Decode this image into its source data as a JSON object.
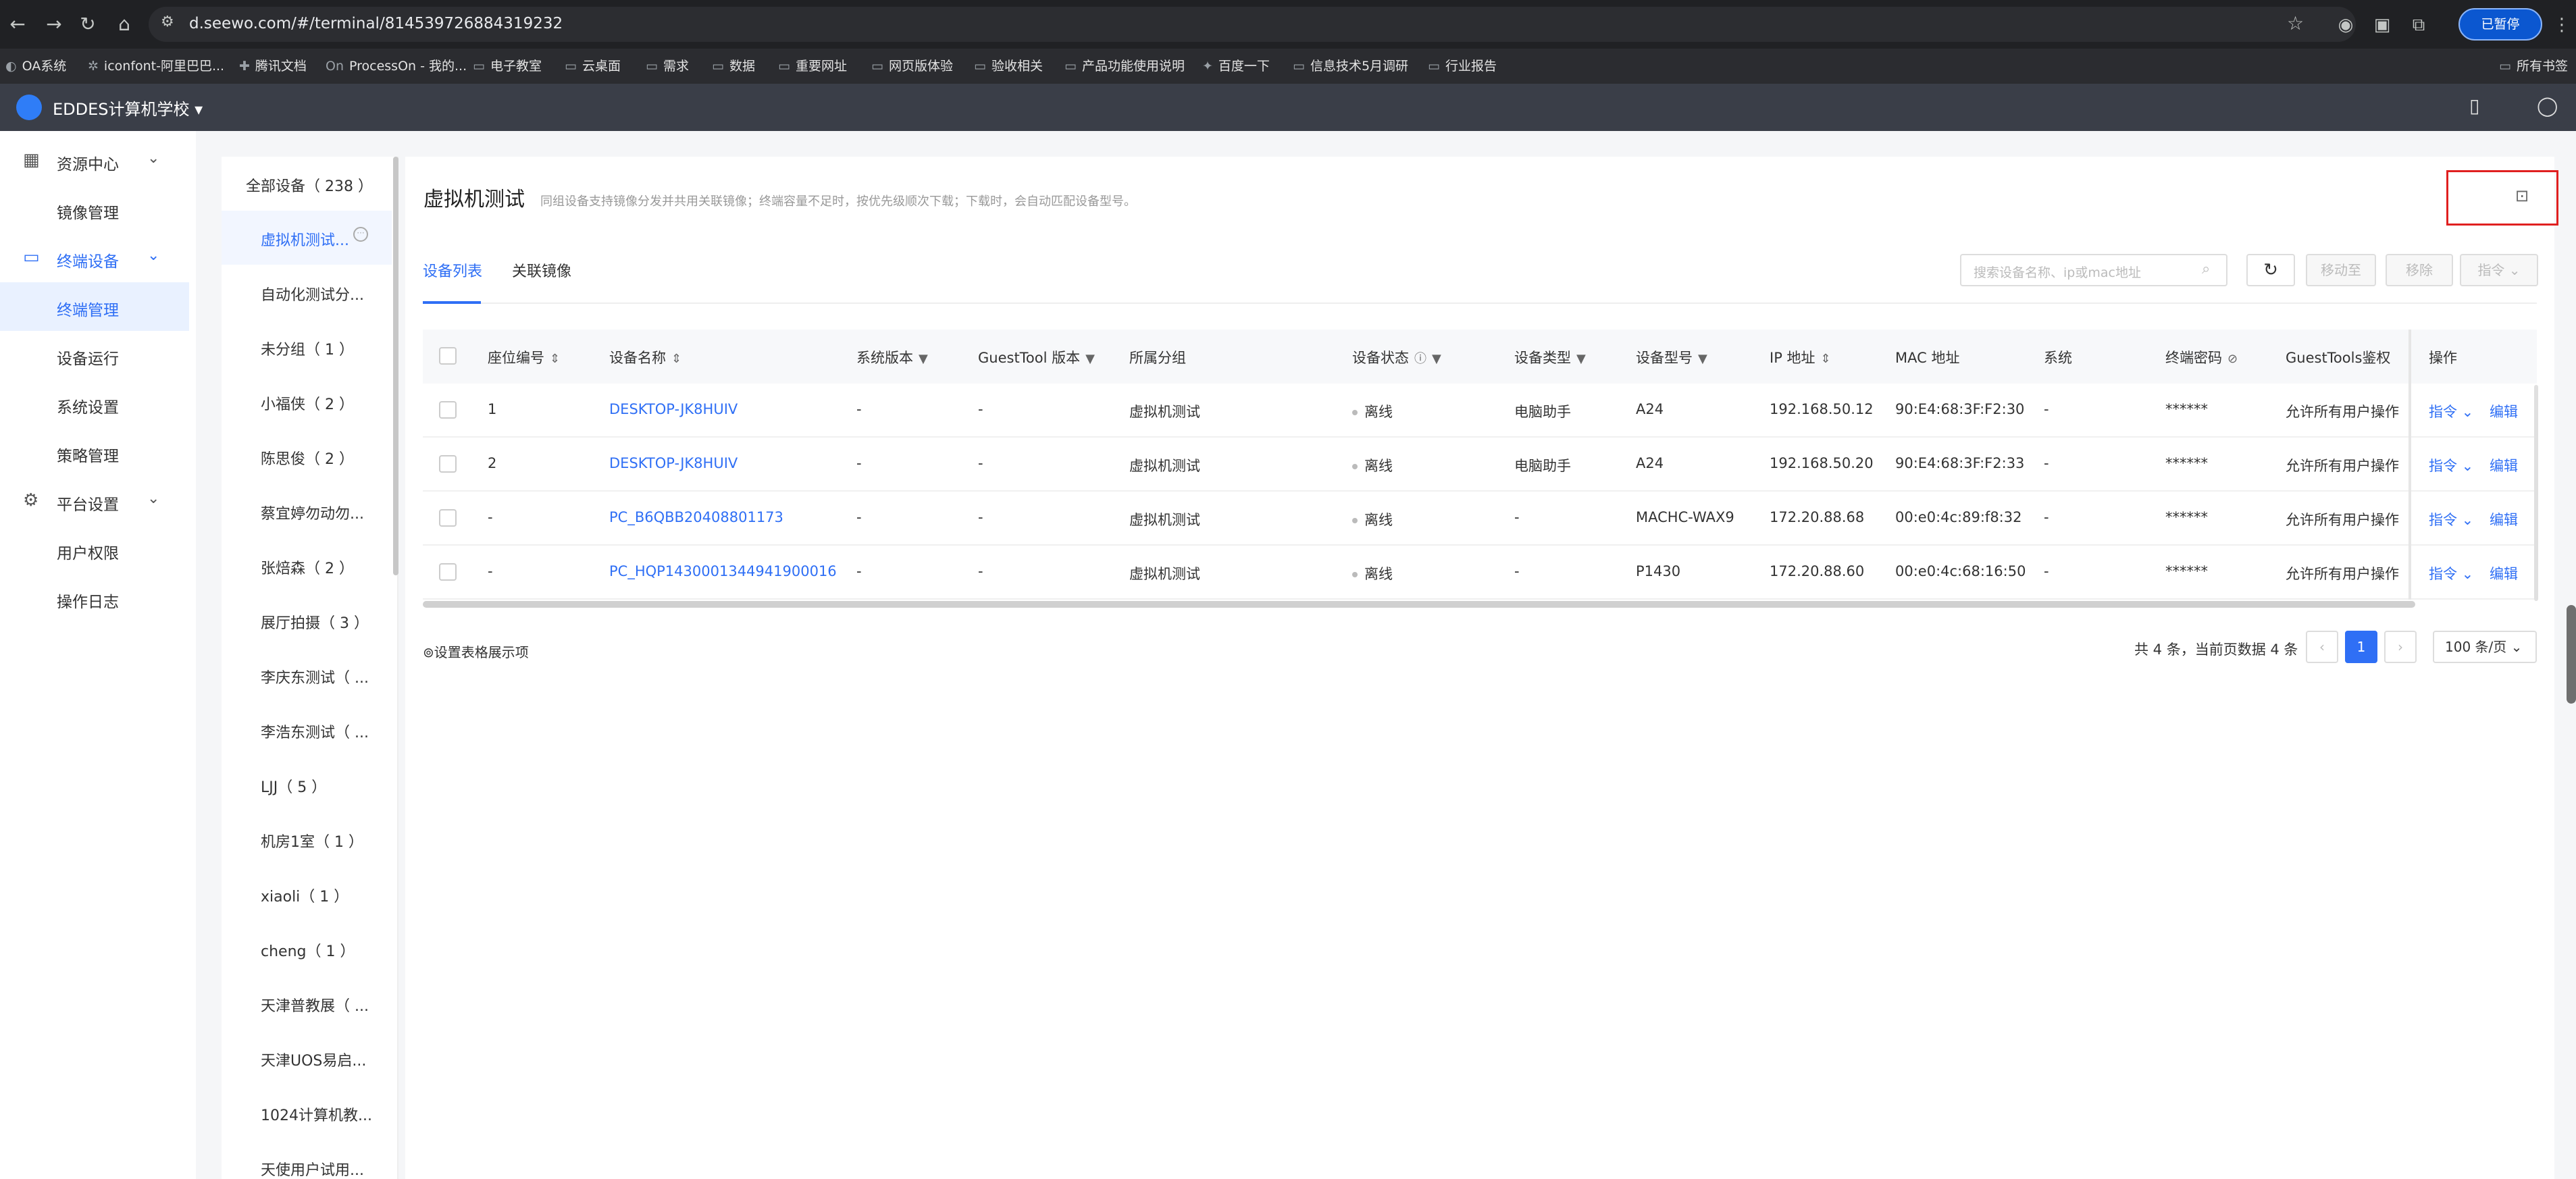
{
  "browser": {
    "url": "d.seewo.com/#/terminal/814539726884319232",
    "profile_label": "已暂停",
    "bookmarks": [
      "OA系统",
      "iconfont-阿里巴巴...",
      "腾讯文档",
      "ProcessOn - 我的...",
      "电子教室",
      "云桌面",
      "需求",
      "数据",
      "重要网址",
      "网页版体验",
      "验收相关",
      "产品功能使用说明",
      "百度一下",
      "信息技术5月调研",
      "行业报告",
      "所有书签"
    ]
  },
  "app": {
    "school_name": "EDDES计算机学校"
  },
  "sidebar": {
    "groups": [
      {
        "label": "资源中心",
        "items": [
          "镜像管理"
        ]
      },
      {
        "label": "终端设备",
        "items": [
          "终端管理",
          "设备运行",
          "系统设置",
          "策略管理"
        ]
      },
      {
        "label": "平台设置",
        "items": [
          "用户权限",
          "操作日志"
        ]
      }
    ]
  },
  "device_groups": [
    "全部设备（ 238 ）",
    "虚拟机测试...",
    "自动化测试分...",
    "未分组（ 1 ）",
    "小福侠（ 2 ）",
    "陈思俊（ 2 ）",
    "蔡宜婷勿动勿...",
    "张焙森（ 2 ）",
    "展厅拍摄（ 3 ）",
    "李庆东测试（ ...",
    "李浩东测试（ ...",
    "LJJ（ 5 ）",
    "机房1室（ 1 ）",
    "xiaoli（ 1 ）",
    "cheng（ 1 ）",
    "天津普教展（ ...",
    "天津UOS易启...",
    "1024计算机教...",
    "天使用户试用..."
  ],
  "main": {
    "title": "虚拟机测试",
    "description": "同组设备支持镜像分发并共用关联镜像；终端容量不足时，按优先级顺次下载；下载时，会自动匹配设备型号。",
    "tabs": [
      "设备列表",
      "关联镜像"
    ],
    "search_placeholder": "搜索设备名称、ip或mac地址",
    "btn_move": "移动至",
    "btn_remove": "移除",
    "btn_command": "指令",
    "settings_link": "设置表格展示项",
    "total_text": "共 4 条，当前页数据 4 条",
    "current_page": "1",
    "page_size": "100 条/页"
  },
  "table": {
    "headers": [
      "座位编号",
      "设备名称",
      "系统版本",
      "GuestTool 版本",
      "所属分组",
      "设备状态",
      "设备类型",
      "设备型号",
      "IP 地址",
      "MAC 地址",
      "系统",
      "终端密码",
      "GuestTools鉴权",
      "操作"
    ],
    "rows": [
      [
        "1",
        "DESKTOP-JK8HUIV",
        "-",
        "-",
        "虚拟机测试",
        "离线",
        "电脑助手",
        "A24",
        "192.168.50.12",
        "90:E4:68:3F:F2:30",
        "-",
        "******",
        "允许所有用户操作",
        "指令",
        "编辑"
      ],
      [
        "2",
        "DESKTOP-JK8HUIV",
        "-",
        "-",
        "虚拟机测试",
        "离线",
        "电脑助手",
        "A24",
        "192.168.50.20",
        "90:E4:68:3F:F2:33",
        "-",
        "******",
        "允许所有用户操作",
        "指令",
        "编辑"
      ],
      [
        "-",
        "PC_B6QBB20408801173",
        "-",
        "-",
        "虚拟机测试",
        "离线",
        "-",
        "MACHC-WAX9",
        "172.20.88.68",
        "00:e0:4c:89:f8:32",
        "-",
        "******",
        "允许所有用户操作",
        "指令",
        "编辑"
      ],
      [
        "-",
        "PC_HQP1430001344941900016",
        "-",
        "-",
        "虚拟机测试",
        "离线",
        "-",
        "P1430",
        "172.20.88.60",
        "00:e0:4c:68:16:50",
        "-",
        "******",
        "允许所有用户操作",
        "指令",
        "编辑"
      ]
    ]
  },
  "colors": {
    "accent": "#2f6ff5",
    "header_bg": "#3a3e48",
    "highlight_box": "#e02020"
  }
}
